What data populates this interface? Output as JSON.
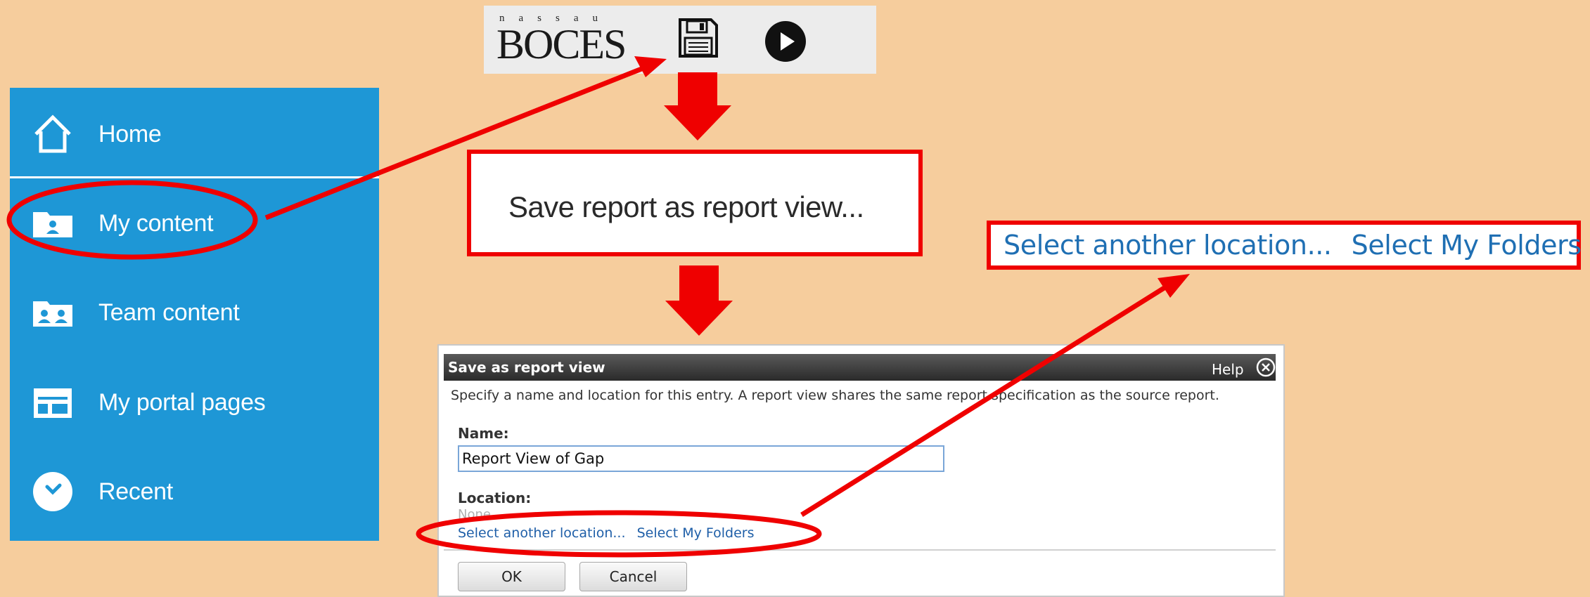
{
  "sidebar": {
    "items": [
      {
        "label": "Home",
        "icon": "home-icon"
      },
      {
        "label": "My content",
        "icon": "my-content-folder-icon"
      },
      {
        "label": "Team content",
        "icon": "team-content-folder-icon"
      },
      {
        "label": "My portal pages",
        "icon": "portal-pages-icon"
      },
      {
        "label": "Recent",
        "icon": "recent-clock-icon"
      }
    ]
  },
  "toolbar": {
    "logo_top": "nassau",
    "logo_main": "BOCES",
    "save_icon": "save-floppy-icon",
    "run_icon": "run-play-icon"
  },
  "save_menu": {
    "label": "Save report as report view..."
  },
  "highlight_links": {
    "select_another": "Select another location...",
    "select_my_folders": "Select My Folders"
  },
  "dialog": {
    "title": "Save as report view",
    "help": "Help",
    "description": "Specify a name and location for this entry. A report view shares the same report specification as the source report.",
    "name_label": "Name:",
    "name_value": "Report View of Gap",
    "location_label": "Location:",
    "location_value": "None",
    "select_another": "Select another location...",
    "select_my_folders": "Select My Folders",
    "ok": "OK",
    "cancel": "Cancel"
  },
  "colors": {
    "background": "#f6cd9d",
    "sidebar": "#1e97d6",
    "annotation_red": "#ef0000",
    "link_blue": "#1f5fa8"
  }
}
